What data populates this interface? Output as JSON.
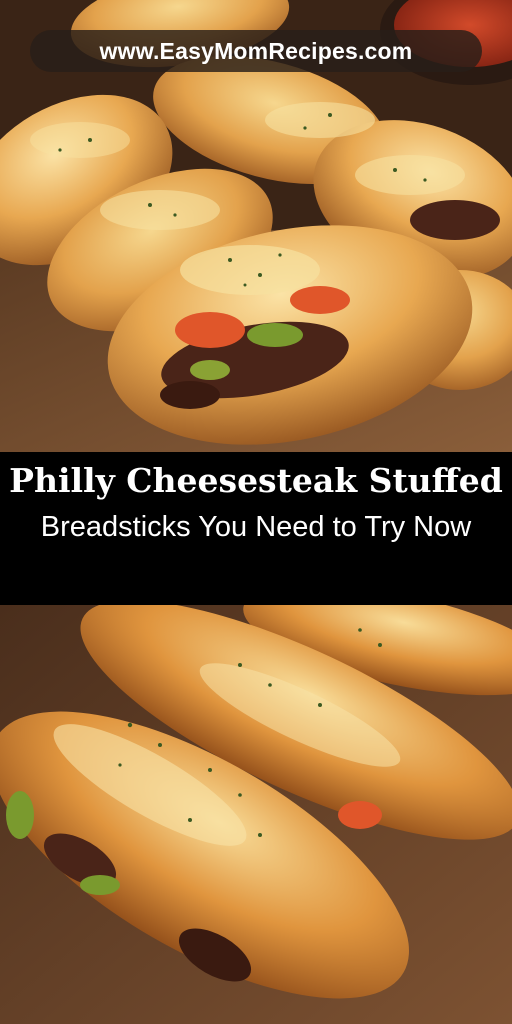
{
  "overlay": {
    "url": "www.EasyMomRecipes.com"
  },
  "title": {
    "line1": "Philly Cheesesteak Stuffed",
    "line2": "Breadsticks You Need to Try Now"
  },
  "colors": {
    "background": "#000000",
    "pill": "#2b1f1a",
    "crust": "#d98a3c",
    "cheese": "#f2c76a",
    "pepper_red": "#e0562a",
    "pepper_green": "#7a9a2e",
    "beef": "#4a2418",
    "board": "#7a5234"
  },
  "photos": [
    {
      "name": "top-photo",
      "subject": "stuffed breadsticks on wooden board with marinara"
    },
    {
      "name": "bottom-photo",
      "subject": "close-up of cheesy stuffed breadsticks"
    }
  ]
}
